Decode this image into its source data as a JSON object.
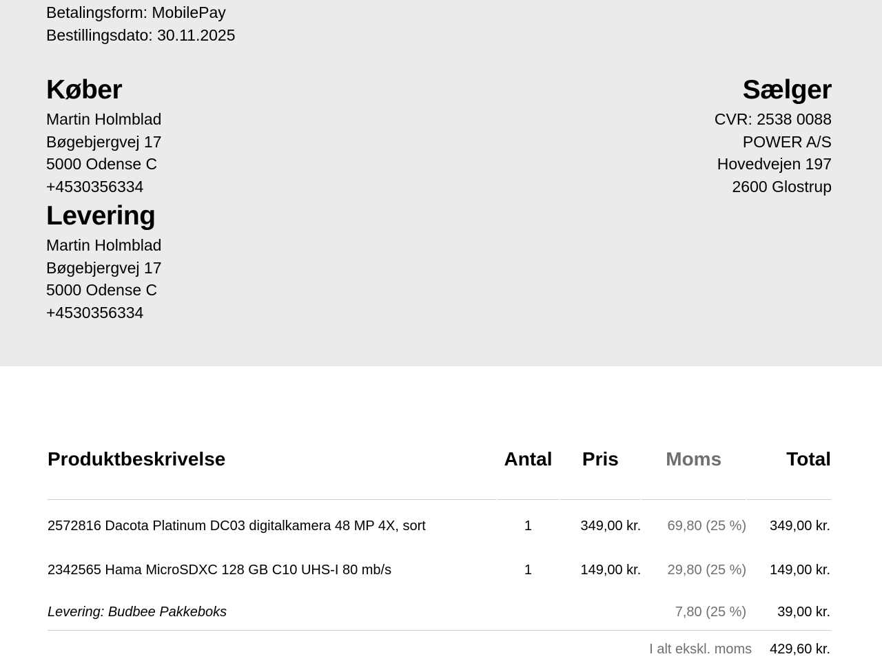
{
  "meta": {
    "payment": "Betalingsform: MobilePay",
    "order_date": "Bestillingsdato: 30.11.2025"
  },
  "buyer": {
    "heading": "Køber",
    "lines": [
      "Martin Holmblad",
      "Bøgebjergvej 17",
      "5000 Odense C",
      "+4530356334"
    ]
  },
  "delivery": {
    "heading": "Levering",
    "lines": [
      "Martin Holmblad",
      "Bøgebjergvej 17",
      "5000 Odense C",
      "+4530356334"
    ]
  },
  "seller": {
    "heading": "Sælger",
    "lines": [
      "CVR: 2538 0088",
      "POWER A/S",
      "Hovedvejen 197",
      "2600 Glostrup"
    ]
  },
  "table": {
    "headers": {
      "description": "Produktbeskrivelse",
      "qty": "Antal",
      "price": "Pris",
      "vat": "Moms",
      "total": "Total"
    },
    "rows": [
      {
        "description": "2572816 Dacota Platinum DC03 digitalkamera 48 MP 4X, sort",
        "qty": "1",
        "price": "349,00 kr.",
        "vat": "69,80 (25 %)",
        "total": "349,00 kr."
      },
      {
        "description": "2342565 Hama MicroSDXC 128 GB C10 UHS-I 80 mb/s",
        "qty": "1",
        "price": "149,00 kr.",
        "vat": "29,80 (25 %)",
        "total": "149,00 kr."
      },
      {
        "description": "Levering: Budbee Pakkeboks",
        "qty": "",
        "price": "",
        "vat": "7,80 (25 %)",
        "total": "39,00 kr."
      }
    ],
    "subtotal_label": "I alt ekskl. moms",
    "subtotal_value": "429,60 kr."
  }
}
